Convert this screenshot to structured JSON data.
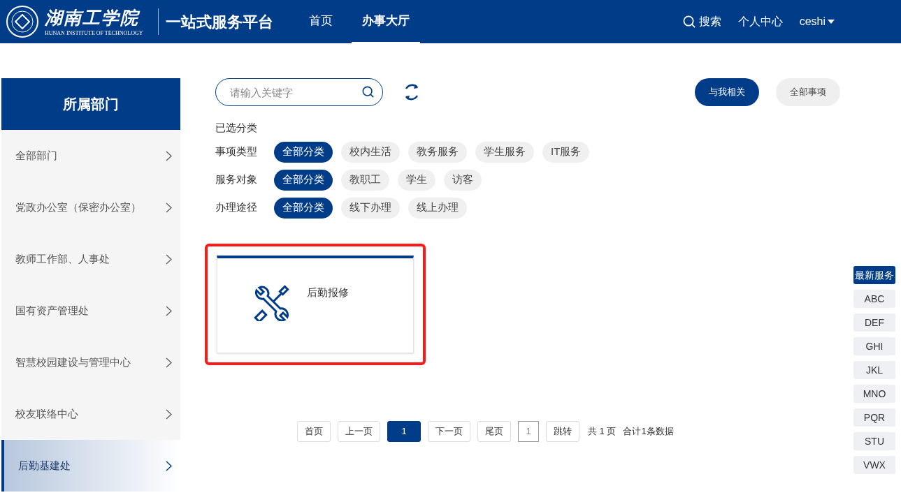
{
  "header": {
    "logo_name": "湖南工学院",
    "logo_subtitle": "HUNAN INSTITUTE OF TECHNOLOGY",
    "platform": "一站式服务平台",
    "nav": [
      {
        "label": "首页",
        "selected": false
      },
      {
        "label": "办事大厅",
        "selected": true
      }
    ],
    "search": "搜索",
    "personal": "个人中心",
    "user": "ceshi"
  },
  "sidebar": {
    "title": "所属部门",
    "items": [
      {
        "label": "全部部门",
        "selected": false
      },
      {
        "label": "党政办公室（保密办公室）",
        "selected": false
      },
      {
        "label": "教师工作部、人事处",
        "selected": false
      },
      {
        "label": "国有资产管理处",
        "selected": false
      },
      {
        "label": "智慧校园建设与管理中心",
        "selected": false
      },
      {
        "label": "校友联络中心",
        "selected": false
      },
      {
        "label": "后勤基建处",
        "selected": true
      }
    ]
  },
  "search": {
    "placeholder": "请输入关键字"
  },
  "scope_buttons": [
    {
      "label": "与我相关",
      "selected": true
    },
    {
      "label": "全部事项",
      "selected": false
    }
  ],
  "selected_heading": "已选分类",
  "filters": [
    {
      "label": "事项类型",
      "options": [
        {
          "label": "全部分类",
          "selected": true
        },
        {
          "label": "校内生活",
          "selected": false
        },
        {
          "label": "教务服务",
          "selected": false
        },
        {
          "label": "学生服务",
          "selected": false
        },
        {
          "label": "IT服务",
          "selected": false
        }
      ]
    },
    {
      "label": "服务对象",
      "options": [
        {
          "label": "全部分类",
          "selected": true
        },
        {
          "label": "教职工",
          "selected": false
        },
        {
          "label": "学生",
          "selected": false
        },
        {
          "label": "访客",
          "selected": false
        }
      ]
    },
    {
      "label": "办理途径",
      "options": [
        {
          "label": "全部分类",
          "selected": true
        },
        {
          "label": "线下办理",
          "selected": false
        },
        {
          "label": "线上办理",
          "selected": false
        }
      ]
    }
  ],
  "services": [
    {
      "title": "后勤报修",
      "highlighted": true
    }
  ],
  "pagination": {
    "first": "首页",
    "prev": "上一页",
    "pages": [
      {
        "label": "1",
        "selected": true
      }
    ],
    "next": "下一页",
    "last": "尾页",
    "jump_value": "1",
    "jump": "跳转",
    "total_pages": "共 1 页",
    "total_records": "合计1条数据"
  },
  "index_tabs": [
    {
      "label": "最新服务",
      "selected": true
    },
    {
      "label": "ABC",
      "selected": false
    },
    {
      "label": "DEF",
      "selected": false
    },
    {
      "label": "GHI",
      "selected": false
    },
    {
      "label": "JKL",
      "selected": false
    },
    {
      "label": "MNO",
      "selected": false
    },
    {
      "label": "PQR",
      "selected": false
    },
    {
      "label": "STU",
      "selected": false
    },
    {
      "label": "VWX",
      "selected": false
    }
  ]
}
